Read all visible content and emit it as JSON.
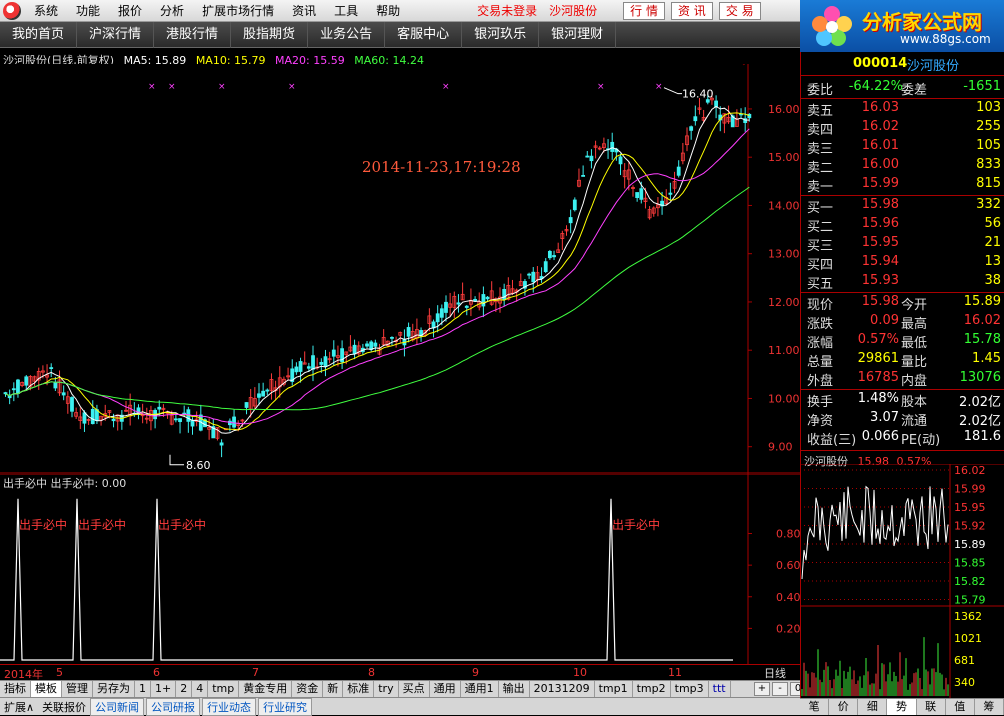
{
  "menu": {
    "items": [
      "系统",
      "功能",
      "报价",
      "分析",
      "扩展市场行情",
      "资讯",
      "工具",
      "帮助"
    ],
    "status": "交易未登录",
    "stock": "沙河股份",
    "buttons": [
      "行 情",
      "资 讯",
      "交 易"
    ]
  },
  "brand": {
    "title": "分析家公式网",
    "url": "www.88gs.com"
  },
  "nav": [
    "我的首页",
    "沪深行情",
    "港股行情",
    "股指期货",
    "业务公告",
    "客服中心",
    "银河玖乐",
    "银河理财"
  ],
  "chart": {
    "title": "沙河股份(日线,前复权)",
    "ma": [
      {
        "label": "MA5: 15.89",
        "color": "#ffffff"
      },
      {
        "label": "MA10: 15.79",
        "color": "#ffff00"
      },
      {
        "label": "MA20: 15.59",
        "color": "#ff40ff"
      },
      {
        "label": "MA60: 14.24",
        "color": "#40ff40"
      }
    ],
    "timestamp": "2014-11-23,17:19:28",
    "high_label": "16.40",
    "low_label": "8.60",
    "signal_mark": "S"
  },
  "chart_data": [
    {
      "type": "candlestick",
      "title": "沙河股份(日线,前复权)",
      "ylim": [
        8.6,
        16.6
      ],
      "yticks": [
        "16.00",
        "15.00",
        "14.00",
        "13.00",
        "12.00",
        "11.00",
        "10.00",
        "9.00"
      ],
      "x": [
        "2014年",
        "5",
        "6",
        "7",
        "8",
        "9",
        "10",
        "11"
      ],
      "series": [
        {
          "name": "MA5",
          "last": 15.89
        },
        {
          "name": "MA10",
          "last": 15.79
        },
        {
          "name": "MA20",
          "last": 15.59
        },
        {
          "name": "MA60",
          "last": 14.24
        }
      ],
      "annotations": [
        "16.40",
        "8.60"
      ]
    },
    {
      "type": "line",
      "title": "出手必中",
      "ylim": [
        0,
        1
      ],
      "yticks": [
        "0.80",
        "0.60",
        "0.40",
        "0.20"
      ],
      "series": [
        {
          "name": "出手必中",
          "last": 0.0
        }
      ],
      "annotations": [
        "出手必中",
        "出手必中",
        "出手必中",
        "出手必中"
      ]
    }
  ],
  "indicator": {
    "title": "出手必中",
    "value_label": "出手必中: 0.00",
    "signal_label": "出手必中"
  },
  "xaxis": {
    "labels": [
      "2014年",
      "5",
      "6",
      "7",
      "8",
      "9",
      "10",
      "11"
    ],
    "period": "日线"
  },
  "tabs1": [
    "指标",
    "模板",
    "管理",
    "另存为",
    "1",
    "1+",
    "2",
    "4",
    "tmp",
    "黄金专用",
    "资金",
    "新",
    "标准",
    "try",
    "买点",
    "通用",
    "通用1",
    "输出",
    "20131209",
    "tmp1",
    "tmp2",
    "tmp3",
    "ttt"
  ],
  "tabs1_active": "模板",
  "ctrls": [
    "+",
    "-",
    "0"
  ],
  "tabs2": [
    "扩展∧",
    "关联报价",
    "公司新闻",
    "公司研报",
    "行业动态",
    "行业研究"
  ],
  "quote": {
    "code": "000014",
    "name": "沙河股份",
    "weibi": {
      "label": "委比",
      "value": "-64.22%",
      "label2": "委差",
      "value2": "-1651"
    },
    "sells": [
      {
        "l": "卖五",
        "p": "16.03",
        "v": "103"
      },
      {
        "l": "卖四",
        "p": "16.02",
        "v": "255"
      },
      {
        "l": "卖三",
        "p": "16.01",
        "v": "105"
      },
      {
        "l": "卖二",
        "p": "16.00",
        "v": "833"
      },
      {
        "l": "卖一",
        "p": "15.99",
        "v": "815"
      }
    ],
    "buys": [
      {
        "l": "买一",
        "p": "15.98",
        "v": "332"
      },
      {
        "l": "买二",
        "p": "15.96",
        "v": "56"
      },
      {
        "l": "买三",
        "p": "15.95",
        "v": "21"
      },
      {
        "l": "买四",
        "p": "15.94",
        "v": "13"
      },
      {
        "l": "买五",
        "p": "15.93",
        "v": "38"
      }
    ],
    "stats": [
      {
        "l": "现价",
        "v": "15.98",
        "l2": "今开",
        "v2": "15.89"
      },
      {
        "l": "涨跌",
        "v": "0.09",
        "l2": "最高",
        "v2": "16.02"
      },
      {
        "l": "涨幅",
        "v": "0.57%",
        "l2": "最低",
        "v2": "15.78"
      },
      {
        "l": "总量",
        "v": "29861",
        "l2": "量比",
        "v2": "1.45"
      },
      {
        "l": "外盘",
        "v": "16785",
        "l2": "内盘",
        "v2": "13076"
      }
    ],
    "stats2": [
      {
        "l": "换手",
        "v": "1.48%",
        "l2": "股本",
        "v2": "2.02亿"
      },
      {
        "l": "净资",
        "v": "3.07",
        "l2": "流通",
        "v2": "2.02亿"
      },
      {
        "l": "收益(三)",
        "v": "0.066",
        "l2": "PE(动)",
        "v2": "181.6"
      }
    ]
  },
  "mini": {
    "name": "沙河股份",
    "price": "15.98",
    "pct": "0.57%",
    "price_ticks": [
      "16.02",
      "15.99",
      "15.95",
      "15.92",
      "15.89",
      "15.85",
      "15.82",
      "15.79"
    ],
    "vol_ticks": [
      "1362",
      "1021",
      "681",
      "340"
    ],
    "tabs": [
      "笔",
      "价",
      "细",
      "势",
      "联",
      "值",
      "筹"
    ],
    "active": "势"
  }
}
